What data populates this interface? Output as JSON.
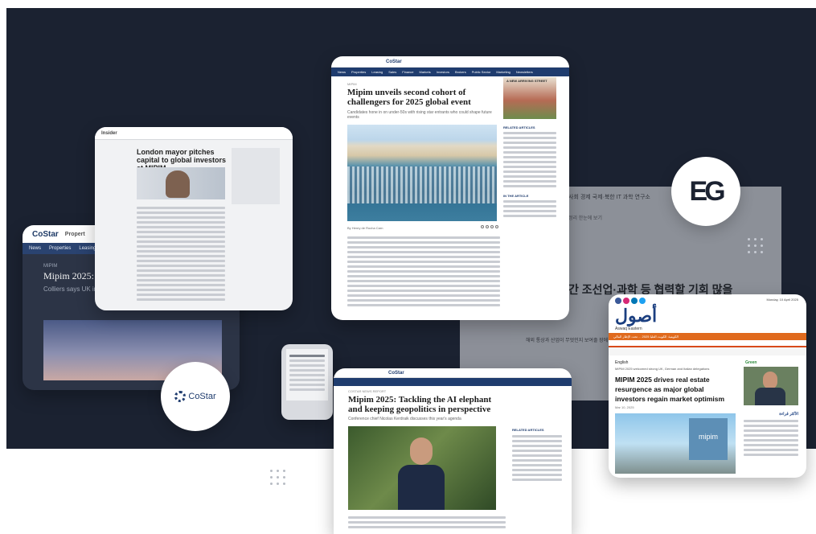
{
  "costar_bg": {
    "brand": "CoStar",
    "nav_fragment": "Propert",
    "nav": [
      "News",
      "Properties",
      "Leasing"
    ],
    "tag": "MIPIM",
    "title": "Mipim 2025: U... flows in 2024",
    "sub": "Colliers says UK invest... load"
  },
  "london": {
    "logo": "Insider",
    "headline": "London mayor pitches capital to global investors at MIPIM"
  },
  "main_article": {
    "brand": "CoStar",
    "nav": [
      "News",
      "Properties",
      "Leasing",
      "Sales",
      "Finance",
      "Markets",
      "Investors",
      "Brokers",
      "Public Sector",
      "Marketing",
      "Newsletters"
    ],
    "kicker": "MIPIM",
    "headline": "Mipim unveils second cohort of challengers for 2025 global event",
    "dek": "Candidates hone in on under-50s with rising star entrants who could shape future events",
    "byline": "By Henry de Rocha Carn",
    "ad_label": "A NEW ARRIVING STREET",
    "side_heading": "RELATED ARTICLES",
    "side_heading_2": "IN THE ARTICLE"
  },
  "ai_article": {
    "brand": "CoStar",
    "kicker": "COSTAR NEWS REPORT",
    "headline": "Mipim 2025: Tackling the AI elephant and keeping geopolitics in perspective",
    "dek": "Conference chief Nicolas Kerdraik discusses this year's agenda",
    "side_heading": "RELATED ARTICLES"
  },
  "korean": {
    "nav": "사회   경제   국제·북한   IT   과학   연구소",
    "nav2": "정리   한눈에 보기",
    "headline": "간 조선업·과학 등 협력할 기회 많을",
    "row": "해외 통상과 산업이 무엇인지 보여줄 장에 새로 이어졌던"
  },
  "arabic": {
    "logo": "أصول",
    "logo_sub": "Aswaq Eastern",
    "date": "Monday, 10 April 2025",
    "ticker": "الكويتية: الكويت العليا 2025 ... تحت الإطار المالي",
    "lang": "English",
    "blurb": "MIPIM 2025 welcomed strong UK, German and Italian delegations",
    "headline": "MIPIM 2025 drives real estate resurgence as major global investors regain market optimism",
    "meta": "Mar 10, 2025",
    "sign": "mipim",
    "green_heading": "Green",
    "side_heading": "الأكثر قراءة"
  },
  "logos": {
    "eg": "EG",
    "costar": "CoStar"
  },
  "colors": {
    "panel": "#1b2231",
    "costar_navy": "#1f3c6e",
    "arabic_orange": "#e06a1d"
  }
}
